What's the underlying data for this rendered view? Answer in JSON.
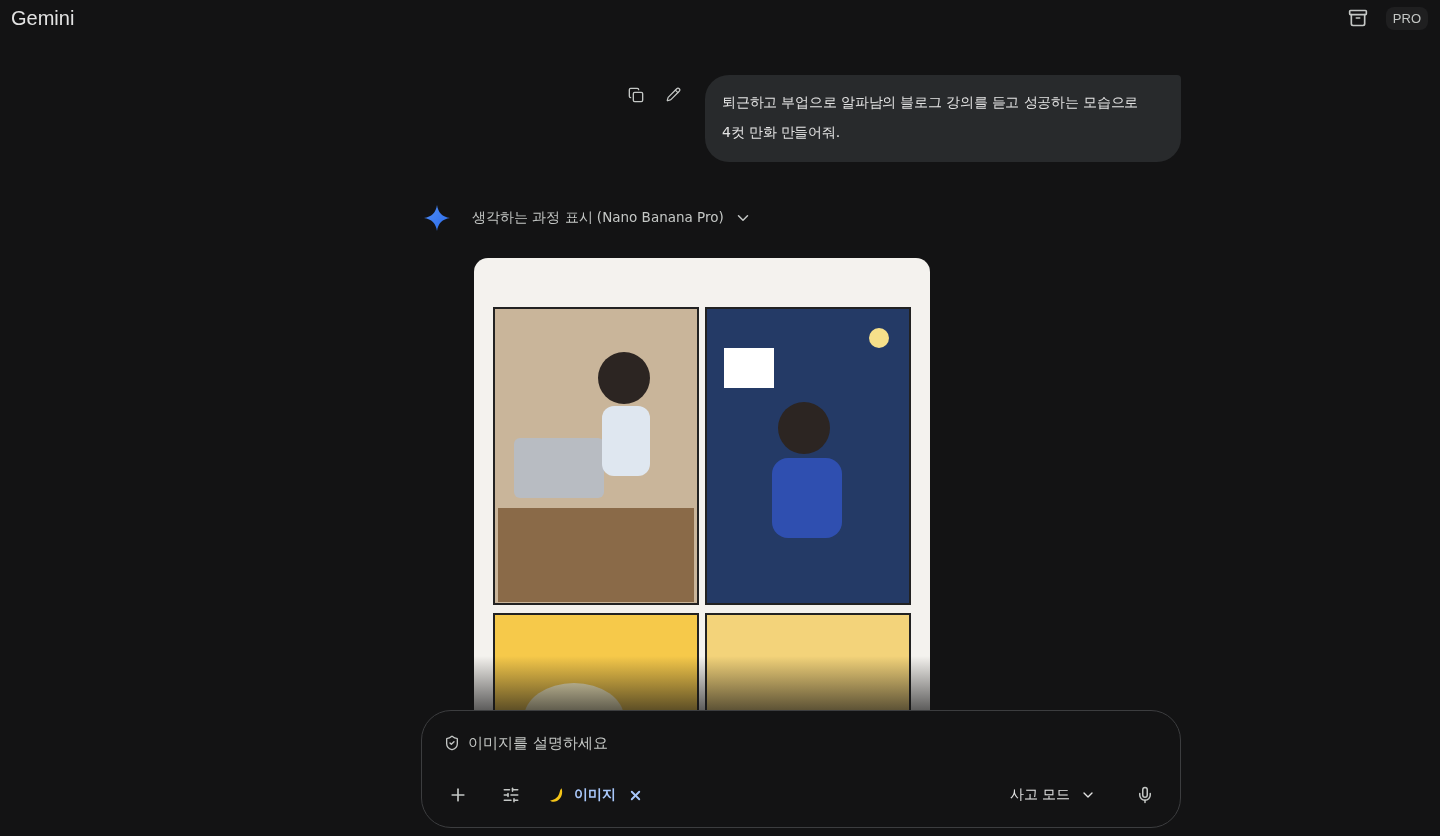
{
  "header": {
    "title": "Gemini",
    "badge": "PRO"
  },
  "user_message": {
    "text": "퇴근하고 부업으로 알파남의 블로그 강의를 듣고 성공하는 모습으로 4컷 만화 만들어줘."
  },
  "response": {
    "thinking_label": "생각하는 과정 표시 (Nano Banana Pro)",
    "expanded": false
  },
  "composer": {
    "placeholder": "이미지를 설명하세요",
    "tool_chip": "이미지",
    "mode": "사고 모드"
  }
}
